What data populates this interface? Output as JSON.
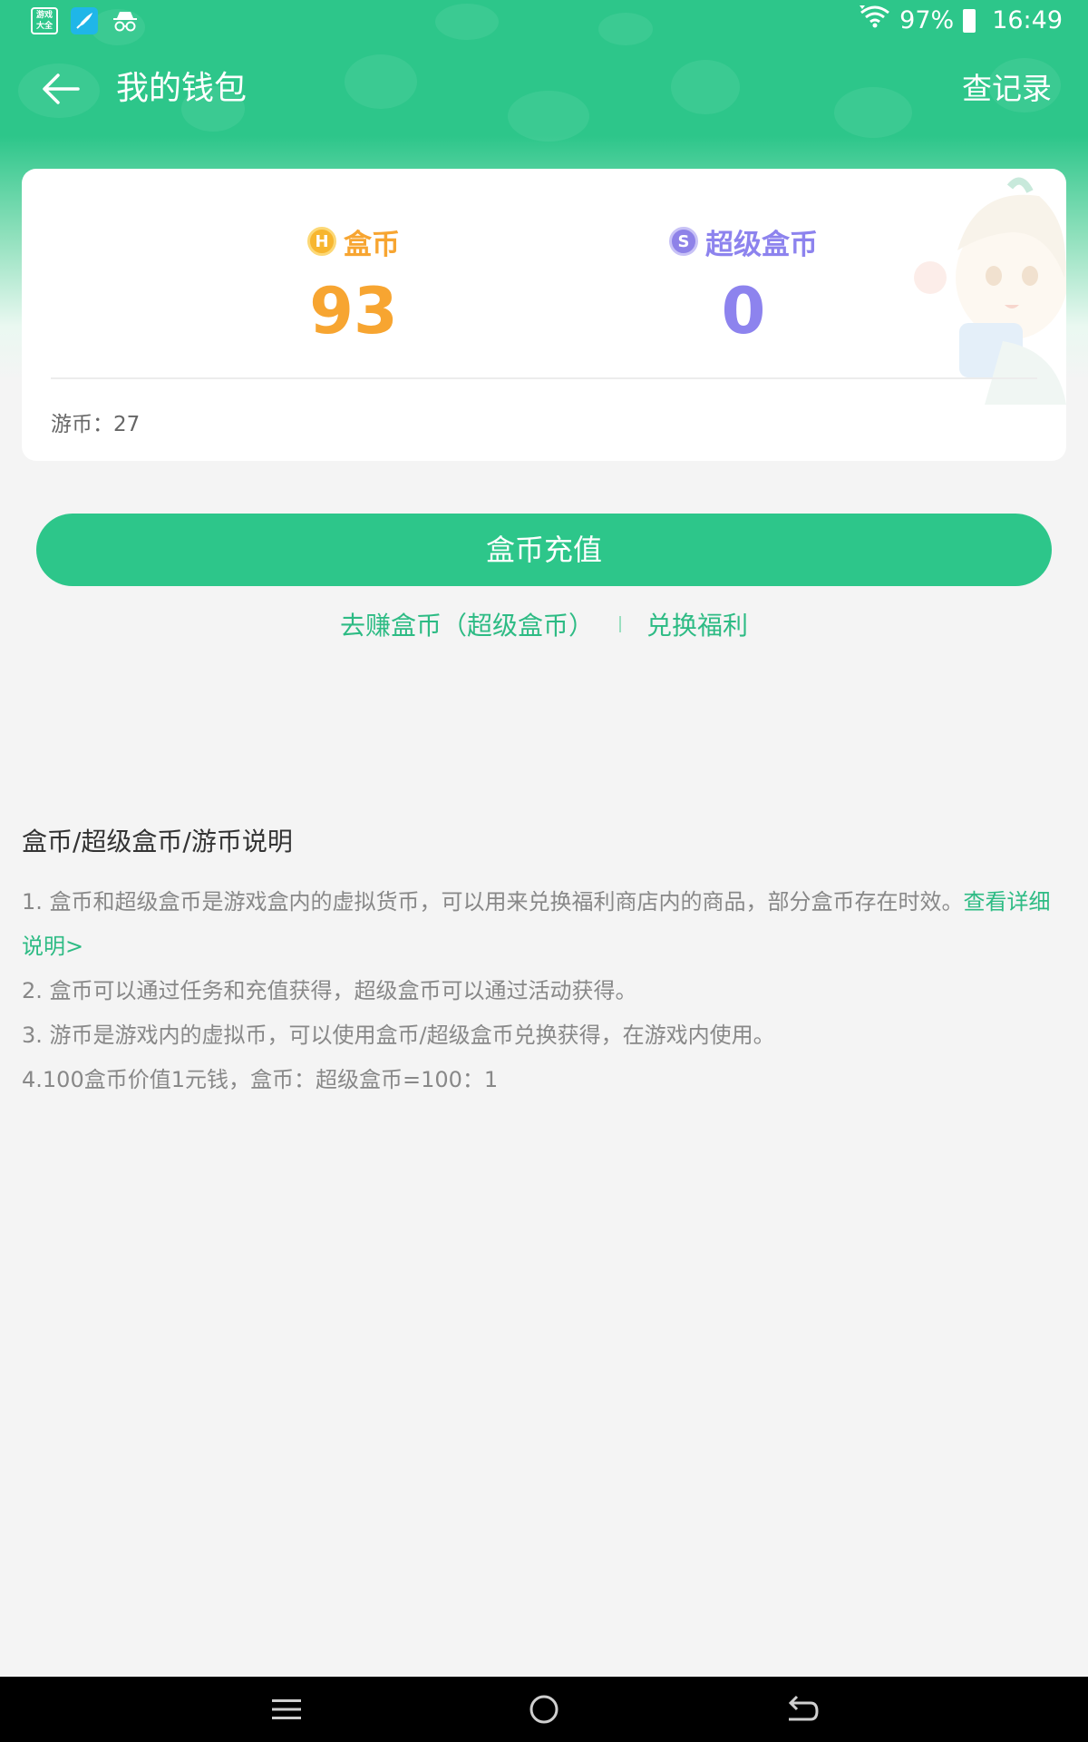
{
  "status_bar": {
    "app_icon_text": "游戏大全",
    "battery": "97%",
    "time": "16:49"
  },
  "app_bar": {
    "title": "我的钱包",
    "records_link": "查记录"
  },
  "wallet": {
    "coin": {
      "icon_letter": "H",
      "label": "盒币",
      "value": "93"
    },
    "super_coin": {
      "icon_letter": "S",
      "label": "超级盒币",
      "value": "0"
    },
    "game_coin": "游币：27"
  },
  "actions": {
    "recharge_label": "盒币充值",
    "earn_link": "去赚盒币（超级盒币）",
    "exchange_link": "兑换福利"
  },
  "instructions": {
    "title": "盒币/超级盒币/游币说明",
    "item1_text": "1. 盒币和超级盒币是游戏盒内的虚拟货币，可以用来兑换福利商店内的商品，部分盒币存在时效。",
    "item1_link": "查看详细说明>",
    "item2": "2. 盒币可以通过任务和充值获得，超级盒币可以通过活动获得。",
    "item3": "3. 游币是游戏内的虚拟币，可以使用盒币/超级盒币兑换获得，在游戏内使用。",
    "item4": "4.100盒币价值1元钱，盒币：超级盒币=100：1"
  },
  "colors": {
    "brand_green": "#2dc68a",
    "coin_orange": "#f7a531",
    "super_coin_purple": "#8d83ee"
  },
  "icons": {
    "back": "arrow-left-icon",
    "coin": "gold-coin-icon",
    "super_coin": "super-coin-icon",
    "nav_menu": "menu-icon",
    "nav_home": "home-circle-icon",
    "nav_back": "back-return-icon"
  }
}
